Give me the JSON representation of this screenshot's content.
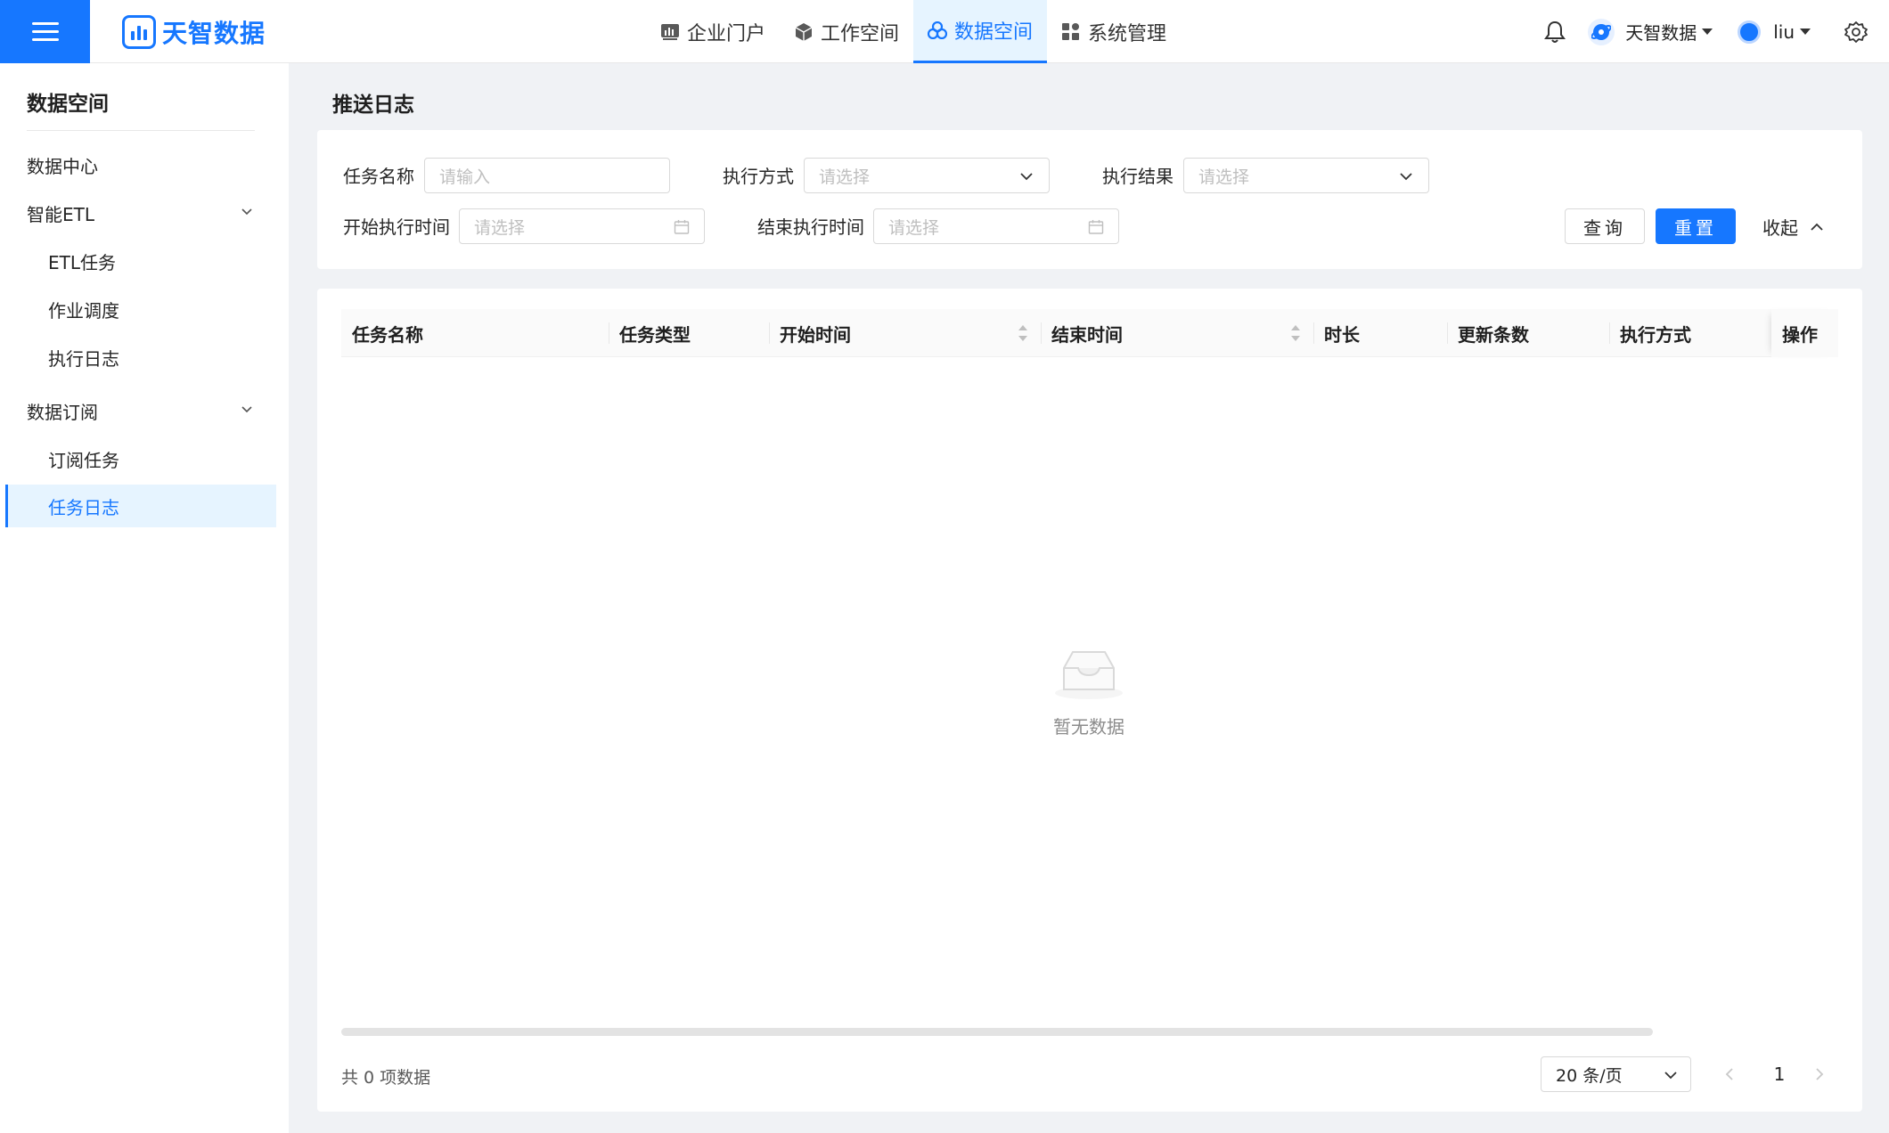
{
  "header": {
    "brand": "天智数据",
    "nav": [
      {
        "label": "企业门户",
        "icon": "bar-chart-icon"
      },
      {
        "label": "工作空间",
        "icon": "cube-icon"
      },
      {
        "label": "数据空间",
        "icon": "cluster-icon",
        "active": true
      },
      {
        "label": "系统管理",
        "icon": "grid-icon"
      }
    ],
    "org_name": "天智数据",
    "user_name": "liu"
  },
  "sidebar": {
    "title": "数据空间",
    "items": [
      {
        "label": "数据中心",
        "level": 1
      },
      {
        "label": "智能ETL",
        "level": 1,
        "expandable": true
      },
      {
        "label": "ETL任务",
        "level": 2
      },
      {
        "label": "作业调度",
        "level": 2
      },
      {
        "label": "执行日志",
        "level": 2
      },
      {
        "label": "数据订阅",
        "level": 1,
        "expandable": true
      },
      {
        "label": "订阅任务",
        "level": 2
      },
      {
        "label": "任务日志",
        "level": 2,
        "active": true
      }
    ]
  },
  "page": {
    "title": "推送日志"
  },
  "filters": {
    "task_name": {
      "label": "任务名称",
      "placeholder": "请输入",
      "value": ""
    },
    "exec_mode": {
      "label": "执行方式",
      "placeholder": "请选择",
      "value": ""
    },
    "exec_result": {
      "label": "执行结果",
      "placeholder": "请选择",
      "value": ""
    },
    "start_time": {
      "label": "开始执行时间",
      "placeholder": "请选择",
      "value": ""
    },
    "end_time": {
      "label": "结束执行时间",
      "placeholder": "请选择",
      "value": ""
    },
    "query_label": "查询",
    "reset_label": "重置",
    "collapse_label": "收起"
  },
  "table": {
    "columns": [
      "任务名称",
      "任务类型",
      "开始时间",
      "结束时间",
      "时长",
      "更新条数",
      "执行方式",
      "操作"
    ],
    "rows": [],
    "empty_text": "暂无数据"
  },
  "pagination": {
    "total_text": "共 0 项数据",
    "page_size": "20 条/页",
    "current_page": "1"
  },
  "colors": {
    "primary": "#1677ff",
    "active_bg": "#e6f4ff"
  }
}
